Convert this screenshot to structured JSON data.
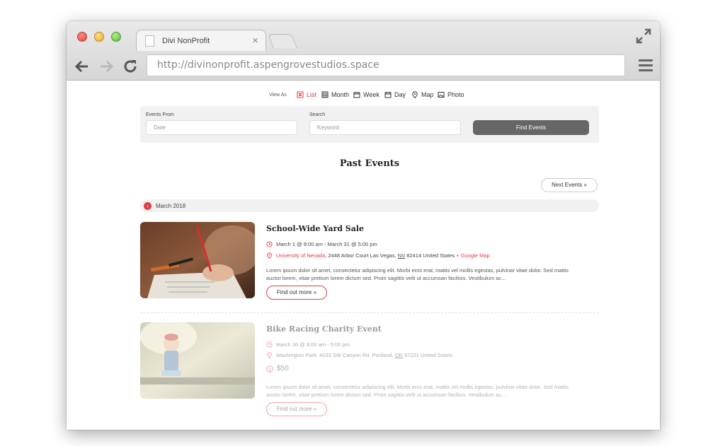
{
  "browser": {
    "tab_title": "Divi NonProfit",
    "tab_close": "×",
    "url": "http://divinonprofit.aspengrovestudios.space"
  },
  "view_as": {
    "label": "View As",
    "options": [
      {
        "label": "List",
        "icon": "list-icon",
        "active": true
      },
      {
        "label": "Month",
        "icon": "month-grid-icon",
        "active": false
      },
      {
        "label": "Week",
        "icon": "week-calendar-icon",
        "active": false
      },
      {
        "label": "Day",
        "icon": "day-calendar-icon",
        "active": false
      },
      {
        "label": "Map",
        "icon": "map-pin-icon",
        "active": false
      },
      {
        "label": "Photo",
        "icon": "photo-icon",
        "active": false
      }
    ]
  },
  "search": {
    "events_from_label": "Events From",
    "date_placeholder": "Date",
    "search_label": "Search",
    "keyword_placeholder": "Keyword",
    "find_button": "Find Events"
  },
  "section_title": "Past Events",
  "next_events": "Next Events »",
  "month_label": "March 2018",
  "events": [
    {
      "title": "School-Wide Yard Sale",
      "time": "March 1 @ 8:00 am - March 31 @ 5:00 pm",
      "venue": "University of Nevada",
      "address": ", 2448 Arbor Court Las Vegas,",
      "state": "NV",
      "zip": "82414 United States",
      "map_link": "+ Google Map",
      "description": "Lorem ipsum dolor sit amet, consectetur adipiscing elit. Morbi eros erat, mattis vel mollis egestas, pulvinar vitae dolor. Sed mattis auctor lorem, vitae pretium lorem dictum sed. Proin sagittis velit ut accumsan facilisis. Vestibulum ac...",
      "more": "Find out more »"
    },
    {
      "title": "Bike Racing Charity Event",
      "time": "March 30 @ 8:00 am - 5:00 pm",
      "venue": "Washington Park,",
      "address": "4033 SW Canyon Rd. Portland,",
      "state": "OR",
      "zip": "97221 United States",
      "price": "$50",
      "description": "Lorem ipsum dolor sit amet, consectetur adipiscing elit. Morbi eros erat, mattis vel mollis egestas, pulvinar vitae dolor. Sed mattis auctor lorem, vitae pretium lorem dictum sed. Proin sagittis velit ut accumsan facilisis. Vestibulum ac...",
      "more": "Find out more »"
    }
  ],
  "colors": {
    "accent": "#e33b43",
    "button_dark": "#666666",
    "panel": "#f1f1f1"
  }
}
